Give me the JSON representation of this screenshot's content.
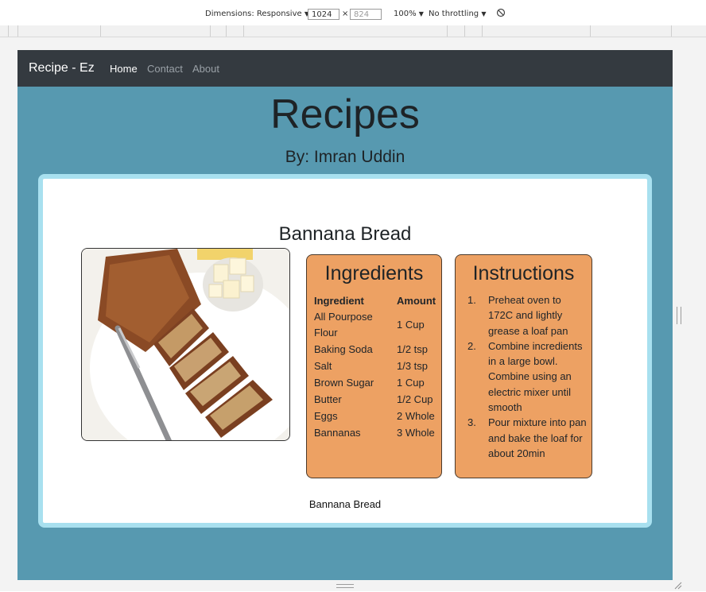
{
  "devtools": {
    "dimensions_label": "Dimensions: Responsive",
    "width": "1024",
    "times": "×",
    "height_placeholder": "824",
    "zoom": "100%",
    "throttling": "No throttling",
    "dropdown_glyph": "▼",
    "rotate_glyph": "⃠"
  },
  "nav": {
    "brand": "Recipe - Ez",
    "links": [
      "Home",
      "Contact",
      "About"
    ]
  },
  "hero": {
    "title": "Recipes",
    "subtitle": "By: Imran Uddin"
  },
  "recipe": {
    "title": "Bannana Bread",
    "caption": "Bannana Bread",
    "ingredients": {
      "heading": "Ingredients",
      "columns": [
        "Ingredient",
        "Amount"
      ],
      "rows": [
        [
          "All Pourpose Flour",
          "1 Cup"
        ],
        [
          "Baking Soda",
          "1/2 tsp"
        ],
        [
          "Salt",
          "1/3 tsp"
        ],
        [
          "Brown Sugar",
          "1 Cup"
        ],
        [
          "Butter",
          "1/2 Cup"
        ],
        [
          "Eggs",
          "2 Whole"
        ],
        [
          "Bannanas",
          "3 Whole"
        ]
      ]
    },
    "instructions": {
      "heading": "Instructions",
      "steps": [
        "Preheat oven to 172C and lightly grease a loaf pan",
        "Combine incredients in a large bowl. Combine using an electric mixer until smooth",
        "Pour mixture into pan and bake the loaf for about 20min"
      ]
    }
  },
  "colors": {
    "navbar": "#343a40",
    "page_bg": "#5799b0",
    "card_border": "#a8e0ef",
    "panel_bg": "#eda163"
  }
}
